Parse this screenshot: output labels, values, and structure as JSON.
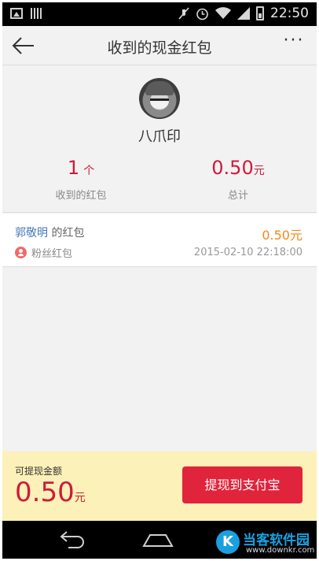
{
  "status_bar": {
    "time": "22:50",
    "icons": [
      "image-icon",
      "barcode-icon",
      "mute-icon",
      "alarm-icon",
      "wifi-icon",
      "signal-icon",
      "battery-icon"
    ]
  },
  "header": {
    "title": "收到的现金红包",
    "back_icon": "back-arrow-icon",
    "more_icon": "more-dots-icon",
    "more_label": "···"
  },
  "summary": {
    "avatar_icon": "user-avatar",
    "username": "八爪印",
    "count_value": "1",
    "count_unit": "个",
    "count_caption": "收到的红包",
    "total_value": "0.50",
    "total_unit": "元",
    "total_caption": "总计"
  },
  "records": [
    {
      "sender_name": "郭敬明",
      "sender_suffix": " 的红包",
      "amount": "0.50元",
      "tag_icon": "fan-user-icon",
      "tag_label": "粉丝红包",
      "time": "2015-02-10 22:18:00"
    }
  ],
  "withdraw": {
    "label": "可提现金额",
    "amount": "0.50",
    "unit": "元",
    "button_label": "提现到支付宝"
  },
  "nav_bar": {
    "back_icon": "nav-back-icon",
    "home_icon": "nav-home-icon"
  },
  "watermark": {
    "logo": "K",
    "text": "当客软件园",
    "url": "www.downkr.com"
  },
  "colors": {
    "accent_red": "#d0193a",
    "amount_orange": "#f08a16",
    "link_blue": "#4a78b8",
    "withdraw_bg": "#fcf1b8",
    "button_red": "#e0243c"
  }
}
